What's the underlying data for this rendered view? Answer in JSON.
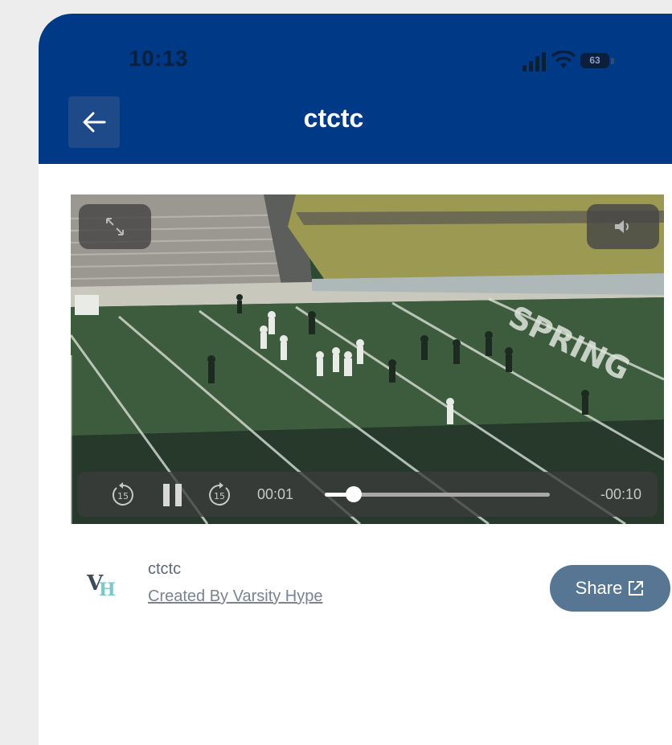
{
  "status_bar": {
    "time": "10:13",
    "battery": "63"
  },
  "nav": {
    "title": "ctctc"
  },
  "video": {
    "current_time": "00:01",
    "remaining_time": "-00:10",
    "progress": 0.13,
    "skip_seconds": "15"
  },
  "info": {
    "logo_text": "VH",
    "title": "ctctc",
    "created_by": "Created By Varsity Hype",
    "share_label": "Share"
  },
  "colors": {
    "header": "#003a87",
    "share": "#567693"
  }
}
